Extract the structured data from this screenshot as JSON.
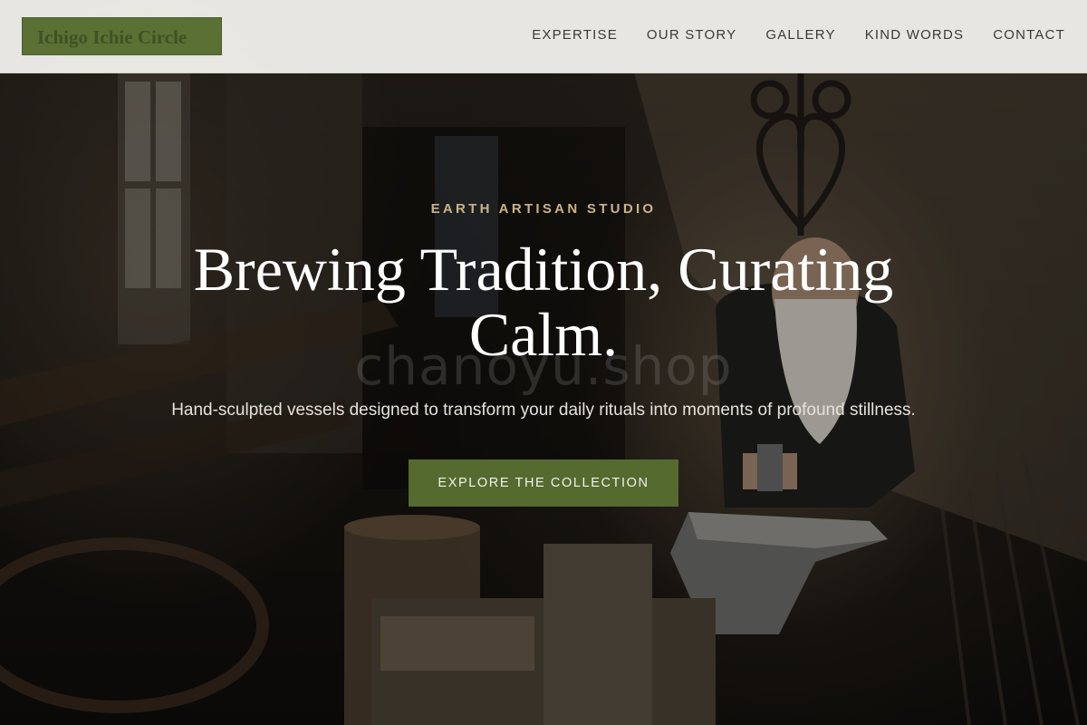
{
  "brand": {
    "logo_text": "Ichigo Ichie Circle",
    "accent_color": "#5a7035"
  },
  "nav": {
    "items": [
      {
        "label": "EXPERTISE"
      },
      {
        "label": "OUR STORY"
      },
      {
        "label": "GALLERY"
      },
      {
        "label": "KIND WORDS"
      },
      {
        "label": "CONTACT"
      }
    ]
  },
  "hero": {
    "eyebrow": "EARTH ARTISAN STUDIO",
    "headline": "Brewing Tradition, Curating Calm.",
    "subtitle": "Hand-sculpted vessels designed to transform your daily rituals into moments of profound stillness.",
    "cta_label": "EXPLORE THE COLLECTION",
    "watermark": "chanoyu.shop",
    "background_image": "artisan-workshop-photo"
  }
}
